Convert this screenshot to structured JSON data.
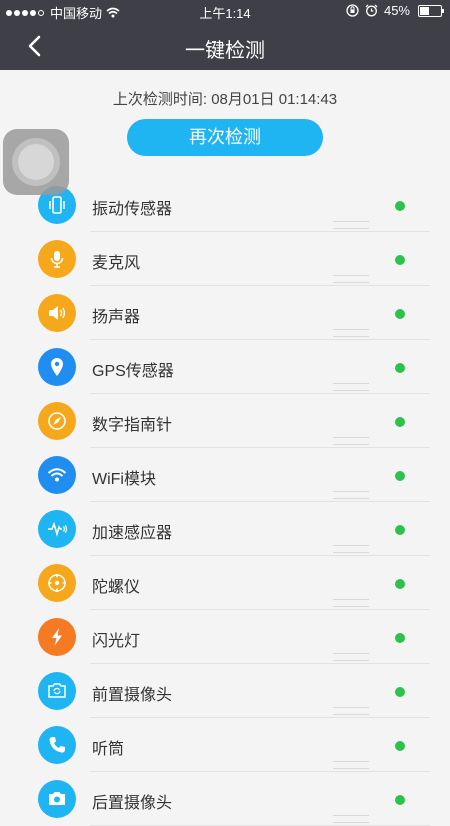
{
  "status_bar": {
    "carrier": "中国移动",
    "time": "上午1:14",
    "battery": "45%",
    "battery_level": 0.45
  },
  "nav": {
    "title": "一键检测"
  },
  "header": {
    "last_check": "上次检测时间: 08月01日 01:14:43",
    "recheck_label": "再次检测"
  },
  "items": [
    {
      "label": "振动传感器",
      "icon": "phone-vibrate-icon",
      "color": "#1fb4f2"
    },
    {
      "label": "麦克风",
      "icon": "microphone-icon",
      "color": "#f6a81c"
    },
    {
      "label": "扬声器",
      "icon": "speaker-icon",
      "color": "#f6a81c"
    },
    {
      "label": "GPS传感器",
      "icon": "location-pin-icon",
      "color": "#1f8ef0"
    },
    {
      "label": "数字指南针",
      "icon": "compass-icon",
      "color": "#f6a81c"
    },
    {
      "label": "WiFi模块",
      "icon": "wifi-icon",
      "color": "#1f8ef0"
    },
    {
      "label": "加速感应器",
      "icon": "pulse-icon",
      "color": "#1fb4f2"
    },
    {
      "label": "陀螺仪",
      "icon": "gyroscope-icon",
      "color": "#f6a81c"
    },
    {
      "label": "闪光灯",
      "icon": "lightning-icon",
      "color": "#f57a23"
    },
    {
      "label": "前置摄像头",
      "icon": "camera-switch-icon",
      "color": "#1fb4f2"
    },
    {
      "label": "听筒",
      "icon": "phone-handset-icon",
      "color": "#1fb4f2"
    },
    {
      "label": "后置摄像头",
      "icon": "camera-icon",
      "color": "#1fb4f2"
    }
  ],
  "status_color": "#2dc24b"
}
